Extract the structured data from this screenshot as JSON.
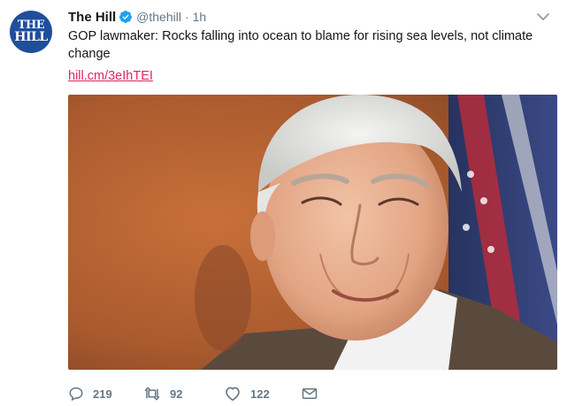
{
  "account": {
    "name": "The Hill",
    "handle": "@thehill",
    "separator": "·",
    "time": "1h",
    "avatar_text_line1": "THE",
    "avatar_text_line2": "HILL"
  },
  "tweet": {
    "text": "GOP lawmaker: Rocks falling into ocean to blame for rising sea levels, not climate change",
    "link": "hill.cm/3eIhTEI"
  },
  "actions": {
    "replies": "219",
    "retweets": "92",
    "likes": "122"
  },
  "icons": {
    "verified": "verified-badge-icon",
    "caret": "chevron-down-icon",
    "reply": "reply-icon",
    "retweet": "retweet-icon",
    "like": "heart-icon",
    "dm": "envelope-icon"
  },
  "colors": {
    "verified_blue": "#1da1f2",
    "link": "#e0245e",
    "muted": "#657786",
    "avatar_bg": "#1f4e9a"
  }
}
